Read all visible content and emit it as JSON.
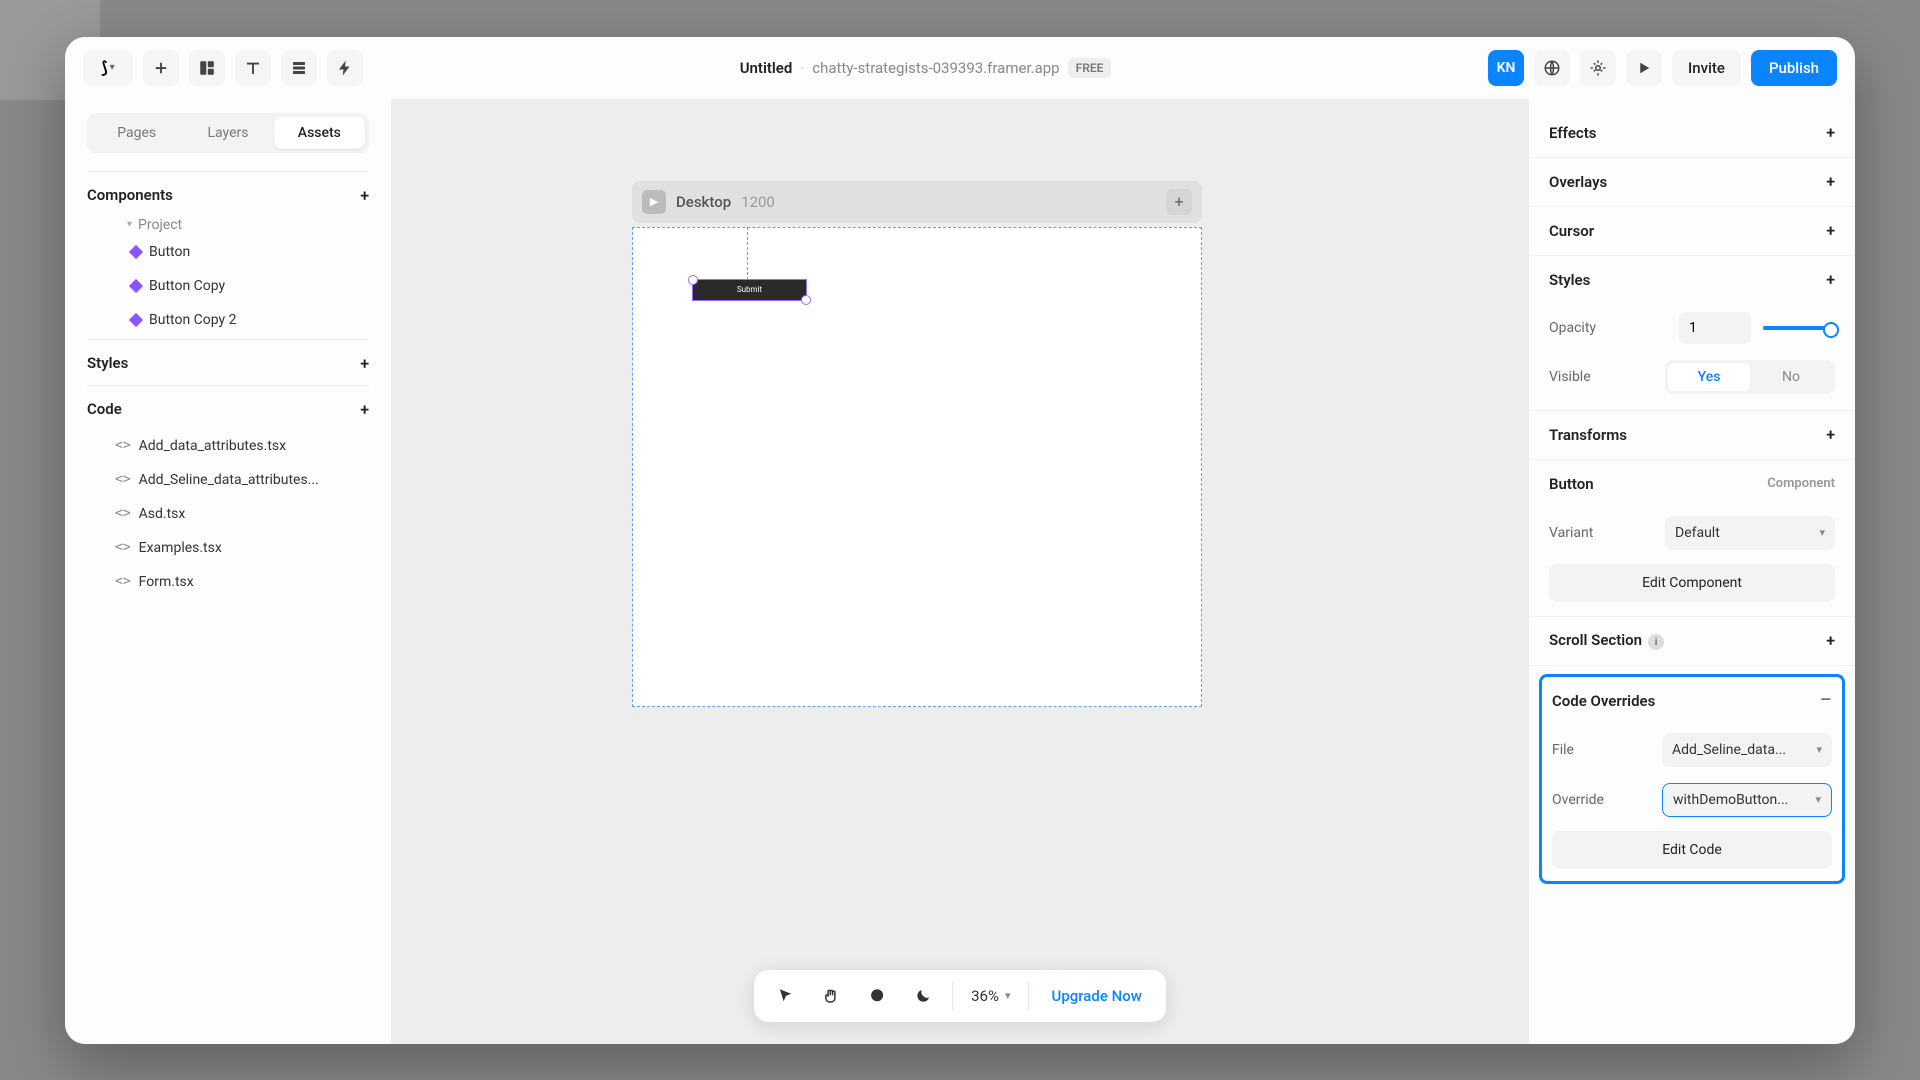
{
  "header": {
    "title": "Untitled",
    "subtitle": "chatty-strategists-039393.framer.app",
    "badge": "FREE",
    "avatar": "KN",
    "invite": "Invite",
    "publish": "Publish"
  },
  "left": {
    "tabs": {
      "pages": "Pages",
      "layers": "Layers",
      "assets": "Assets"
    },
    "components": {
      "title": "Components",
      "folder": "Project",
      "items": [
        "Button",
        "Button Copy",
        "Button Copy 2"
      ]
    },
    "styles": {
      "title": "Styles"
    },
    "code": {
      "title": "Code",
      "files": [
        "Add_data_attributes.tsx",
        "Add_Seline_data_attributes...",
        "Asd.tsx",
        "Examples.tsx",
        "Form.tsx"
      ]
    }
  },
  "canvas": {
    "frame_name": "Desktop",
    "frame_size": "1200",
    "button_label": "Submit"
  },
  "bottom": {
    "zoom": "36%",
    "upgrade": "Upgrade Now"
  },
  "right": {
    "effects": "Effects",
    "overlays": "Overlays",
    "cursor": "Cursor",
    "styles": {
      "title": "Styles",
      "opacity_label": "Opacity",
      "opacity_value": "1",
      "visible_label": "Visible",
      "yes": "Yes",
      "no": "No"
    },
    "transforms": "Transforms",
    "button_section": {
      "title": "Button",
      "sub": "Component",
      "variant_label": "Variant",
      "variant_value": "Default",
      "edit": "Edit Component"
    },
    "scroll": "Scroll Section",
    "overrides": {
      "title": "Code Overrides",
      "file_label": "File",
      "file_value": "Add_Seline_data...",
      "override_label": "Override",
      "override_value": "withDemoButton...",
      "edit": "Edit Code"
    }
  }
}
